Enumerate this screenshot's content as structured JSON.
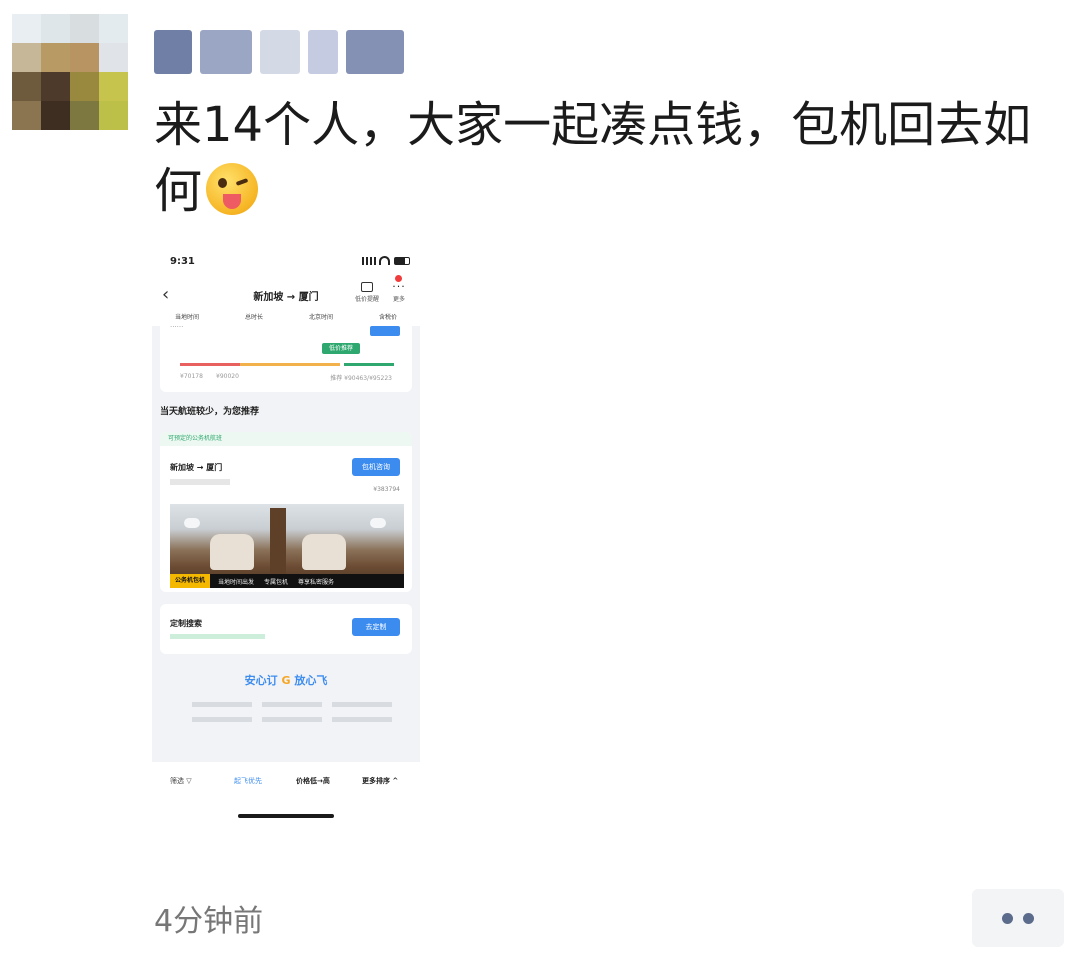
{
  "post": {
    "text_line1": "来14个人，大家一起凑点钱，包机回去如",
    "text_line2": "何",
    "emoji": "winking-face-with-tongue",
    "time_ago": "4分钟前"
  },
  "screenshot": {
    "status_time": "9:31",
    "nav_title": "新加坡 → 厦门",
    "nav_action1": "低价提醒",
    "nav_action2": "更多",
    "tabs": [
      "当地时间",
      "总时长",
      "北京时间",
      "含税价"
    ],
    "price_badge": "低价推荐",
    "price_low": "¥70178",
    "price_mid": "¥90020",
    "price_high": "推荐 ¥90463/¥95223",
    "recommend_heading": "当天航班较少，为您推荐",
    "jet_tag": "可预定的公务机航班",
    "jet_route": "新加坡 → 厦门",
    "jet_button": "包机咨询",
    "jet_price": "¥383794",
    "cabin_badge": "公务机包机",
    "cabin_tags": [
      "当地时间出发",
      "专属包机",
      "尊享私密服务"
    ],
    "custom_title": "定制搜索",
    "custom_button": "去定制",
    "promo_left": "安心订",
    "promo_right": "放心飞",
    "bottom_bar": [
      "筛选 ▽",
      "起飞优先",
      "价格低→高",
      "更多排序 ^"
    ]
  },
  "colors": {
    "accent_blue": "#3c8cf0",
    "green": "#2fa86f",
    "meta_gray": "#777777",
    "more_dots": "#5b6b8c"
  }
}
